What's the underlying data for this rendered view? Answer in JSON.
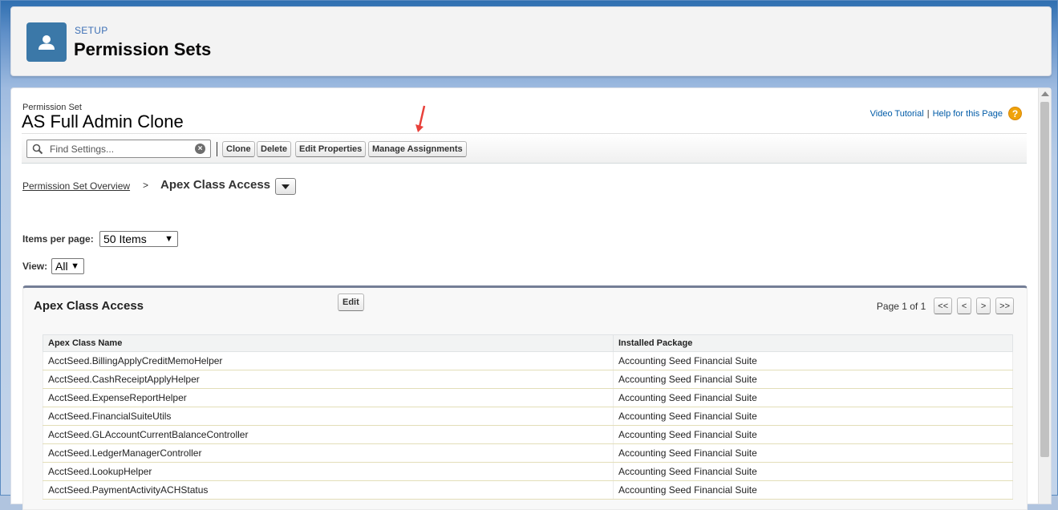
{
  "header": {
    "eyebrow": "SETUP",
    "title": "Permission Sets"
  },
  "permission_set": {
    "label": "Permission Set",
    "name": "AS Full Admin Clone"
  },
  "help": {
    "video_tutorial": "Video Tutorial",
    "separator": "|",
    "help_page": "Help for this Page",
    "help_icon": "?"
  },
  "toolbar": {
    "search_placeholder": "Find Settings...",
    "buttons": {
      "clone": "Clone",
      "delete": "Delete",
      "edit_properties": "Edit Properties",
      "manage_assignments": "Manage Assignments"
    }
  },
  "breadcrumb": {
    "overview": "Permission Set Overview",
    "separator": ">",
    "current": "Apex Class Access"
  },
  "filters": {
    "items_per_page_label": "Items per page:",
    "items_per_page_value": "50 Items",
    "view_label": "View:",
    "view_value": "All"
  },
  "section": {
    "title": "Apex Class Access",
    "edit": "Edit",
    "page_text": "Page 1 of 1",
    "first": "<<",
    "prev": "<",
    "next": ">",
    "last": ">>"
  },
  "table": {
    "columns": [
      "Apex Class Name",
      "Installed Package"
    ],
    "rows": [
      [
        "AcctSeed.BillingApplyCreditMemoHelper",
        "Accounting Seed Financial Suite"
      ],
      [
        "AcctSeed.CashReceiptApplyHelper",
        "Accounting Seed Financial Suite"
      ],
      [
        "AcctSeed.ExpenseReportHelper",
        "Accounting Seed Financial Suite"
      ],
      [
        "AcctSeed.FinancialSuiteUtils",
        "Accounting Seed Financial Suite"
      ],
      [
        "AcctSeed.GLAccountCurrentBalanceController",
        "Accounting Seed Financial Suite"
      ],
      [
        "AcctSeed.LedgerManagerController",
        "Accounting Seed Financial Suite"
      ],
      [
        "AcctSeed.LookupHelper",
        "Accounting Seed Financial Suite"
      ],
      [
        "AcctSeed.PaymentActivityACHStatus",
        "Accounting Seed Financial Suite"
      ]
    ]
  },
  "colors": {
    "accent": "#3b78a8",
    "link": "#015ba7",
    "annotation_arrow": "#e8403a"
  }
}
